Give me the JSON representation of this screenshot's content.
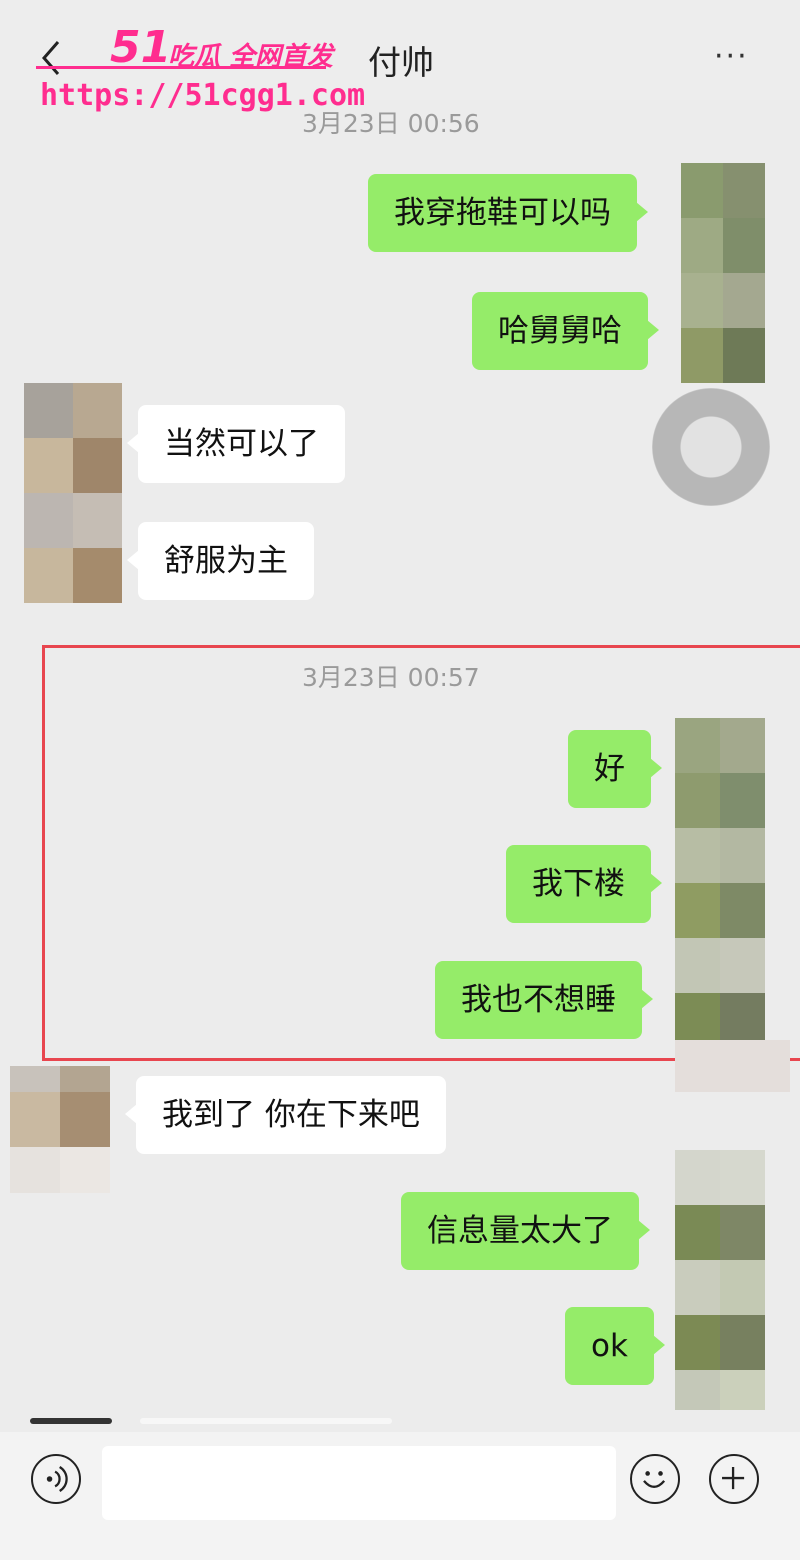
{
  "header": {
    "title": "付帅",
    "back_icon": "chevron-left-icon",
    "more_icon": "more-horizontal-icon",
    "more_label": "···"
  },
  "watermark": {
    "logo": "51",
    "tagline": "吃瓜 全网首发",
    "url": "https://51cgg1.com"
  },
  "colors": {
    "my_bubble": "#95ec69",
    "their_bubble": "#ffffff",
    "highlight_border": "#e8464f",
    "watermark": "#ff2d8f"
  },
  "messages": {
    "ts1": "3月23日 00:56",
    "ts2": "3月23日 00:57",
    "m1": "我穿拖鞋可以吗",
    "m2": "哈舅舅哈",
    "m3": "当然可以了",
    "m4": "舒服为主",
    "m5": "好",
    "m6": "我下楼",
    "m7": "我也不想睡",
    "m8": "我到了 你在下来吧",
    "m9": "信息量太大了",
    "m10": "ok"
  },
  "input_bar": {
    "voice_icon": "voice-icon",
    "emoji_icon": "emoji-icon",
    "plus_icon": "plus-icon",
    "input_value": ""
  }
}
